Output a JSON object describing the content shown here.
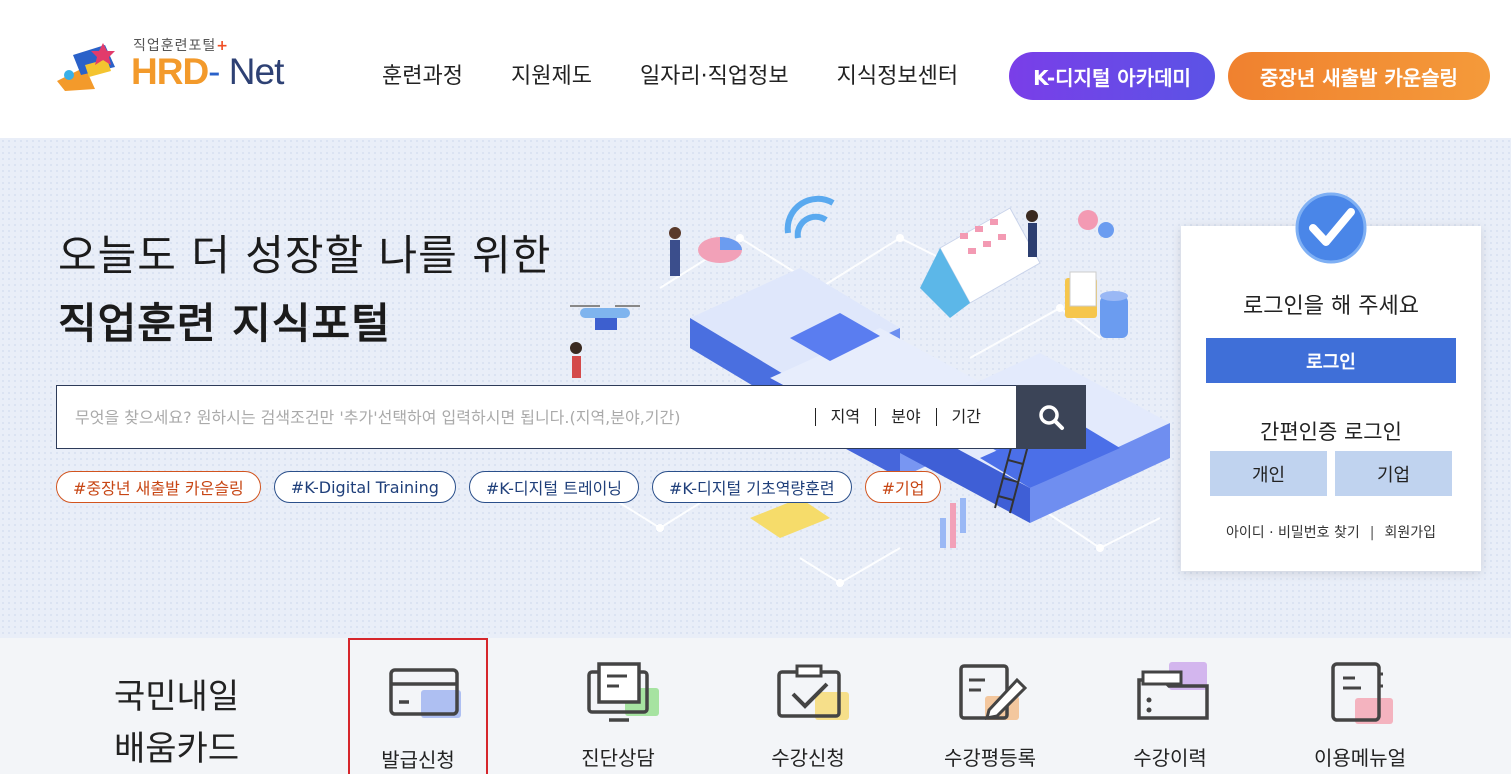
{
  "header": {
    "logo_sub": "직업훈련포털",
    "logo_hrd": "HRD",
    "logo_dash": "-",
    "logo_net": "Net",
    "nav": [
      "훈련과정",
      "지원제도",
      "일자리·직업정보",
      "지식정보센터"
    ],
    "pill_kdt": "K-디지털 아카데미",
    "pill_mid": "중장년 새출발 카운슬링"
  },
  "hero": {
    "title_line1": "오늘도 더 성장할 나를 위한",
    "title_line2": "직업훈련 지식포털",
    "search_placeholder": "무엇을 찾으세요? 원하시는 검색조건만 '추가'선택하여 입력하시면 됩니다.(지역,분야,기간)",
    "filters": [
      "지역",
      "분야",
      "기간"
    ],
    "tags": [
      "#중장년 새출발 카운슬링",
      "#K-Digital Training",
      "#K-디지털 트레이닝",
      "#K-디지털 기초역량훈련",
      "#기업"
    ]
  },
  "login": {
    "message": "로그인을 해 주세요",
    "login_button": "로그인",
    "easy_title": "간편인증 로그인",
    "person_button": "개인",
    "corp_button": "기업",
    "find_link": "아이디 · 비밀번호 찾기",
    "join_link": "회원가입"
  },
  "quick": {
    "title_line1": "국민내일",
    "title_line2": "배움카드",
    "items": [
      "발급신청",
      "진단상담",
      "수강신청",
      "수강평등록",
      "수강이력",
      "이용메뉴얼"
    ]
  },
  "colors": {
    "primary": "#3f6fd8",
    "kdt_purple": "#6a49e7",
    "orange": "#f0812f",
    "selected_border": "#d6262b"
  }
}
